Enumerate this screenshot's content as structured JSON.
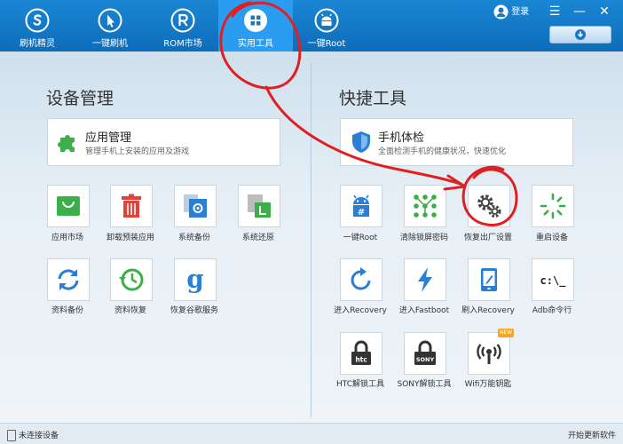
{
  "nav": {
    "items": [
      {
        "label": "刷机精灵"
      },
      {
        "label": "一键刷机"
      },
      {
        "label": "ROM市场"
      },
      {
        "label": "实用工具"
      },
      {
        "label": "一键Root"
      }
    ],
    "login_label": "登录",
    "menu_glyph": "☰",
    "minimize_glyph": "—",
    "close_glyph": "✕"
  },
  "device_section": {
    "title": "设备管理",
    "card": {
      "title": "应用管理",
      "subtitle": "管理手机上安装的应用及游戏"
    },
    "tiles": [
      {
        "label": "应用市场",
        "icon": "store-bag-icon"
      },
      {
        "label": "卸载预装应用",
        "icon": "trash-icon"
      },
      {
        "label": "系统备份",
        "icon": "system-backup-icon"
      },
      {
        "label": "系统还原",
        "icon": "system-restore-icon"
      },
      {
        "label": "资料备份",
        "icon": "sync-icon"
      },
      {
        "label": "资料恢复",
        "icon": "clock-restore-icon"
      },
      {
        "label": "恢复谷歌服务",
        "icon": "google-icon"
      }
    ]
  },
  "quick_section": {
    "title": "快捷工具",
    "card": {
      "title": "手机体检",
      "subtitle": "全面检测手机的健康状况，快速优化"
    },
    "tiles": [
      {
        "label": "一键Root",
        "icon": "android-root-icon"
      },
      {
        "label": "清除锁屏密码",
        "icon": "pattern-lock-icon"
      },
      {
        "label": "恢复出厂设置",
        "icon": "gears-icon"
      },
      {
        "label": "重启设备",
        "icon": "loading-spinner-icon"
      },
      {
        "label": "进入Recovery",
        "icon": "refresh-icon"
      },
      {
        "label": "进入Fastboot",
        "icon": "lightning-icon"
      },
      {
        "label": "刷入Recovery",
        "icon": "tablet-icon"
      },
      {
        "label": "Adb命令行",
        "icon": "cmd-icon",
        "glyph": "c:\\_"
      },
      {
        "label": "HTC解锁工具",
        "icon": "htc-lock-icon",
        "glyph": "htc"
      },
      {
        "label": "SONY解锁工具",
        "icon": "sony-lock-icon",
        "glyph": "SONY"
      },
      {
        "label": "Wifi万能钥匙",
        "icon": "wifi-key-icon",
        "badge": "NEW"
      }
    ]
  },
  "status": {
    "left": "未连接设备",
    "right": "开始更新软件"
  },
  "colors": {
    "topbar": "#1479c7",
    "active_tab": "#2b9df0",
    "green": "#3cae4a",
    "red": "#e0433a",
    "blue": "#2a7fd4",
    "annotation": "#e02020"
  }
}
